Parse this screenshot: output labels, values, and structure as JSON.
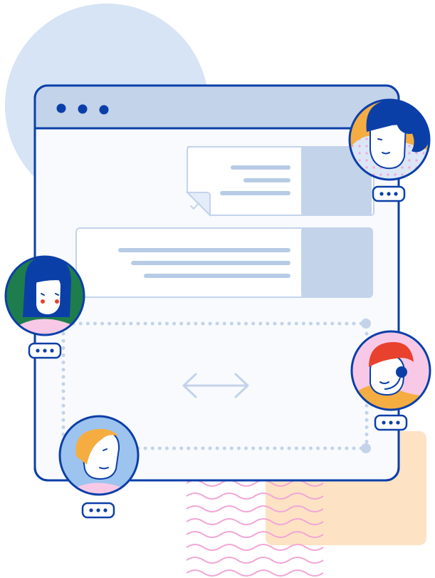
{
  "colors": {
    "navy": "#0b3fa8",
    "lightBlue": "#d6e4f5",
    "panelBlue": "#c3d3ea",
    "lineBlue": "#b7cbe6",
    "peach": "#fde3c4",
    "pink": "#f2a7d6",
    "green": "#1e7d4d",
    "orange": "#f5ad42",
    "red": "#e8412e",
    "skyAvatar": "#9dc4ef"
  },
  "window": {
    "traffic_lights": [
      "dot",
      "dot",
      "dot"
    ]
  },
  "cards": [
    {
      "name": "reply-card",
      "state": "checked"
    },
    {
      "name": "message-card",
      "state": "default"
    }
  ],
  "icons": {
    "arrow": "double-arrow-icon",
    "check": "check-icon",
    "ellipsis": "ellipsis-icon"
  },
  "avatars": [
    {
      "name": "avatar-woman-dark-hair",
      "typing": true
    },
    {
      "name": "avatar-woman-bob",
      "typing": true
    },
    {
      "name": "avatar-headset-agent",
      "typing": true
    },
    {
      "name": "avatar-man-orange-hair",
      "typing": true
    }
  ]
}
